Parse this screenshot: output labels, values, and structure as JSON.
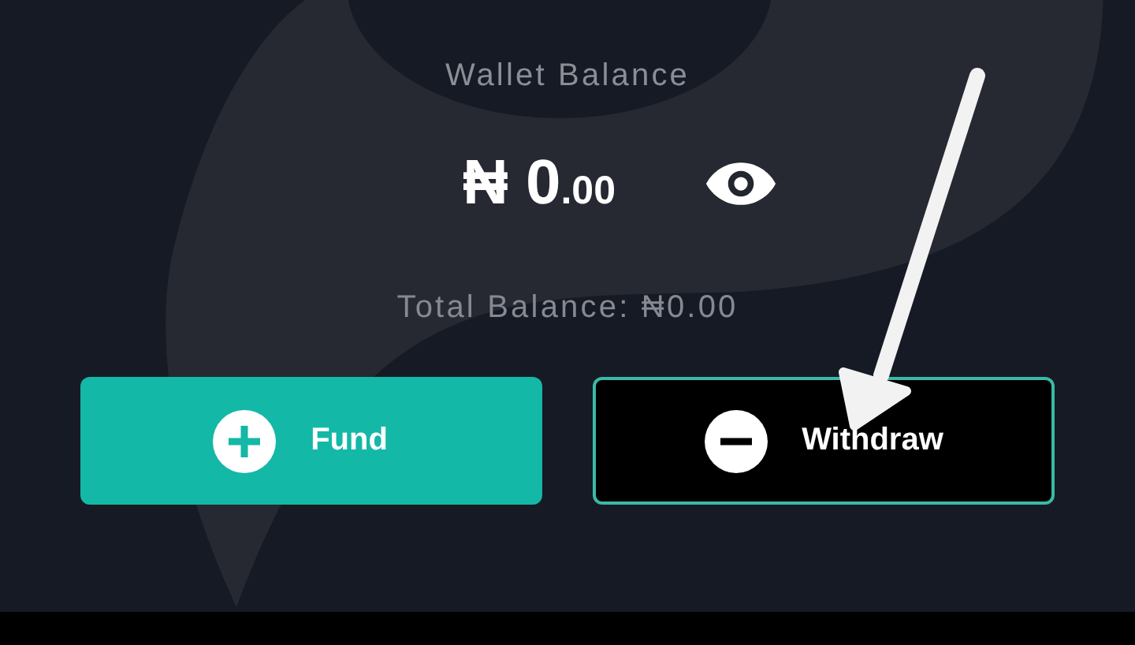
{
  "wallet": {
    "title": "Wallet Balance",
    "amount": "₦ 0",
    "decimals": ".00",
    "total_balance": "Total Balance: ₦0.00"
  },
  "buttons": [
    {
      "label": "Fund",
      "kind": "fund"
    },
    {
      "label": "Withdraw",
      "kind": "withdraw"
    }
  ]
}
